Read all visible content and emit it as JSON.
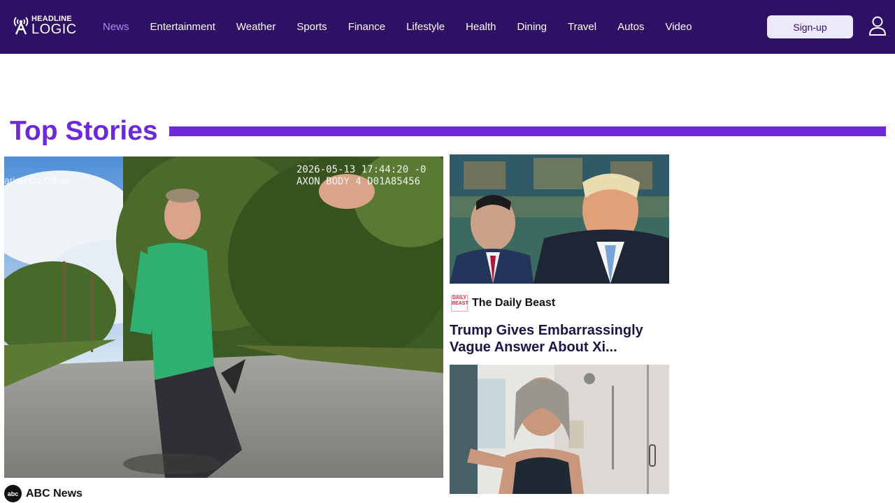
{
  "brand": {
    "line1": "HEADLINE",
    "line2": "LOGIC"
  },
  "nav": {
    "items": [
      {
        "label": "News",
        "active": true
      },
      {
        "label": "Entertainment"
      },
      {
        "label": "Weather"
      },
      {
        "label": "Sports"
      },
      {
        "label": "Finance"
      },
      {
        "label": "Lifestyle"
      },
      {
        "label": "Health"
      },
      {
        "label": "Dining"
      },
      {
        "label": "Travel"
      },
      {
        "label": "Autos"
      },
      {
        "label": "Video"
      }
    ]
  },
  "header": {
    "signup_label": "Sign-up",
    "user_icon": "user-icon"
  },
  "section": {
    "title": "Top Stories"
  },
  "hero": {
    "overlay_timestamp": "2026-05-13 17:44:20 -0",
    "overlay_device": "AXON BODY 4 D01A85456",
    "overlay_watermark": "arion Co        Office",
    "source": "ABC News",
    "source_logo_text": "abc"
  },
  "story1": {
    "source": "The Daily Beast",
    "source_logo_text": "DAILY BEAST",
    "headline": "Trump Gives Embarrassingly Vague Answer About Xi..."
  },
  "colors": {
    "topbar": "#2e1065",
    "accent": "#6d28d9",
    "active_nav": "#a78bfa",
    "signup_bg": "#ece9fb"
  }
}
